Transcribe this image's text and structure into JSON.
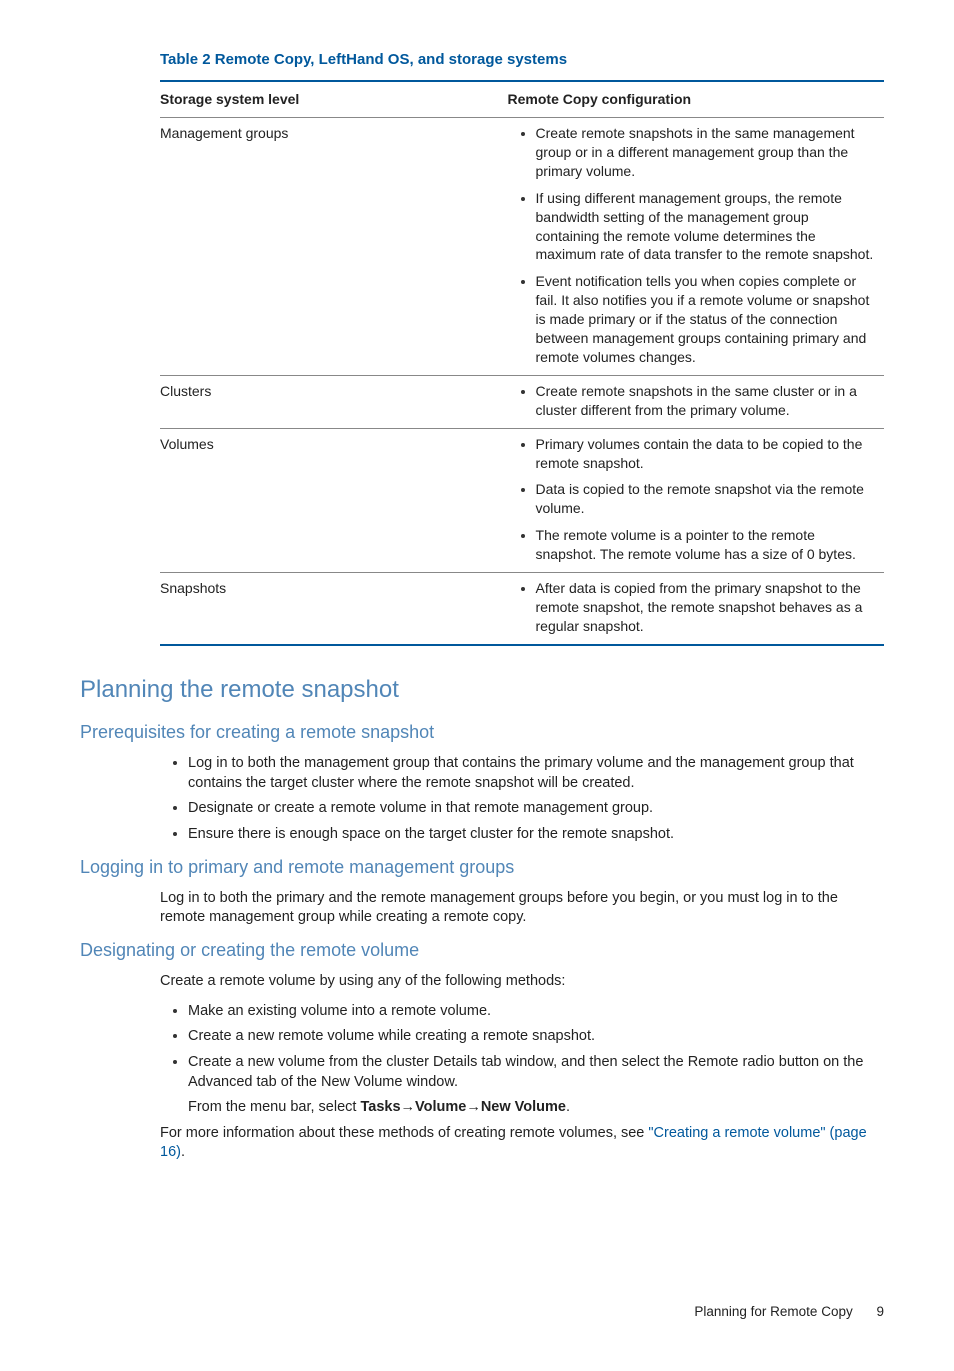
{
  "table": {
    "caption": "Table 2 Remote Copy, LeftHand OS, and storage systems",
    "headers": {
      "col1": "Storage system level",
      "col2": "Remote Copy configuration"
    },
    "rows": {
      "r0": {
        "label": "Management groups",
        "items": {
          "i0": "Create remote snapshots in the same management group or in a different management group than the primary volume.",
          "i1": "If using different management groups, the remote bandwidth setting of the management group containing the remote volume determines the maximum rate of data transfer to the remote snapshot.",
          "i2": "Event notification tells you when copies complete or fail. It also notifies you if a remote volume or snapshot is made primary or if the status of the connection between management groups containing primary and remote volumes changes."
        }
      },
      "r1": {
        "label": "Clusters",
        "items": {
          "i0": "Create remote snapshots in the same cluster or in a cluster different from the primary volume."
        }
      },
      "r2": {
        "label": "Volumes",
        "items": {
          "i0": "Primary volumes contain the data to be copied to the remote snapshot.",
          "i1": "Data is copied to the remote snapshot via the remote volume.",
          "i2": "The remote volume is a pointer to the remote snapshot. The remote volume has a size of 0 bytes."
        }
      },
      "r3": {
        "label": "Snapshots",
        "items": {
          "i0": "After data is copied from the primary snapshot to the remote snapshot, the remote snapshot behaves as a regular snapshot."
        }
      }
    }
  },
  "sections": {
    "planning_title": "Planning the remote snapshot",
    "prereq": {
      "title": "Prerequisites for creating a remote snapshot",
      "items": {
        "i0": "Log in to both the management group that contains the primary volume and the management group that contains the target cluster where the remote snapshot will be created.",
        "i1": "Designate or create a remote volume in that remote management group.",
        "i2": "Ensure there is enough space on the target cluster for the remote snapshot."
      }
    },
    "logging": {
      "title": "Logging in to primary and remote management groups",
      "para": "Log in to both the primary and the remote management groups before you begin, or you must log in to the remote management group while creating a remote copy."
    },
    "designating": {
      "title": "Designating or creating the remote volume",
      "intro": "Create a remote volume by using any of the following methods:",
      "items": {
        "i0": "Make an existing volume into a remote volume.",
        "i1": "Create a new remote volume while creating a remote snapshot.",
        "i2_a": "Create a new volume from the cluster Details tab window, and then select the Remote radio button on the Advanced tab of the New Volume window.",
        "i2_b_pre": "From the menu bar, select ",
        "i2_b_bold1": "Tasks",
        "i2_b_bold2": "Volume",
        "i2_b_bold3": "New Volume"
      },
      "outro_pre": "For more information about these methods of creating remote volumes, see ",
      "outro_link": "\"Creating a remote volume\" (page 16)",
      "outro_post": "."
    }
  },
  "footer": {
    "title": "Planning for Remote Copy",
    "page": "9"
  }
}
